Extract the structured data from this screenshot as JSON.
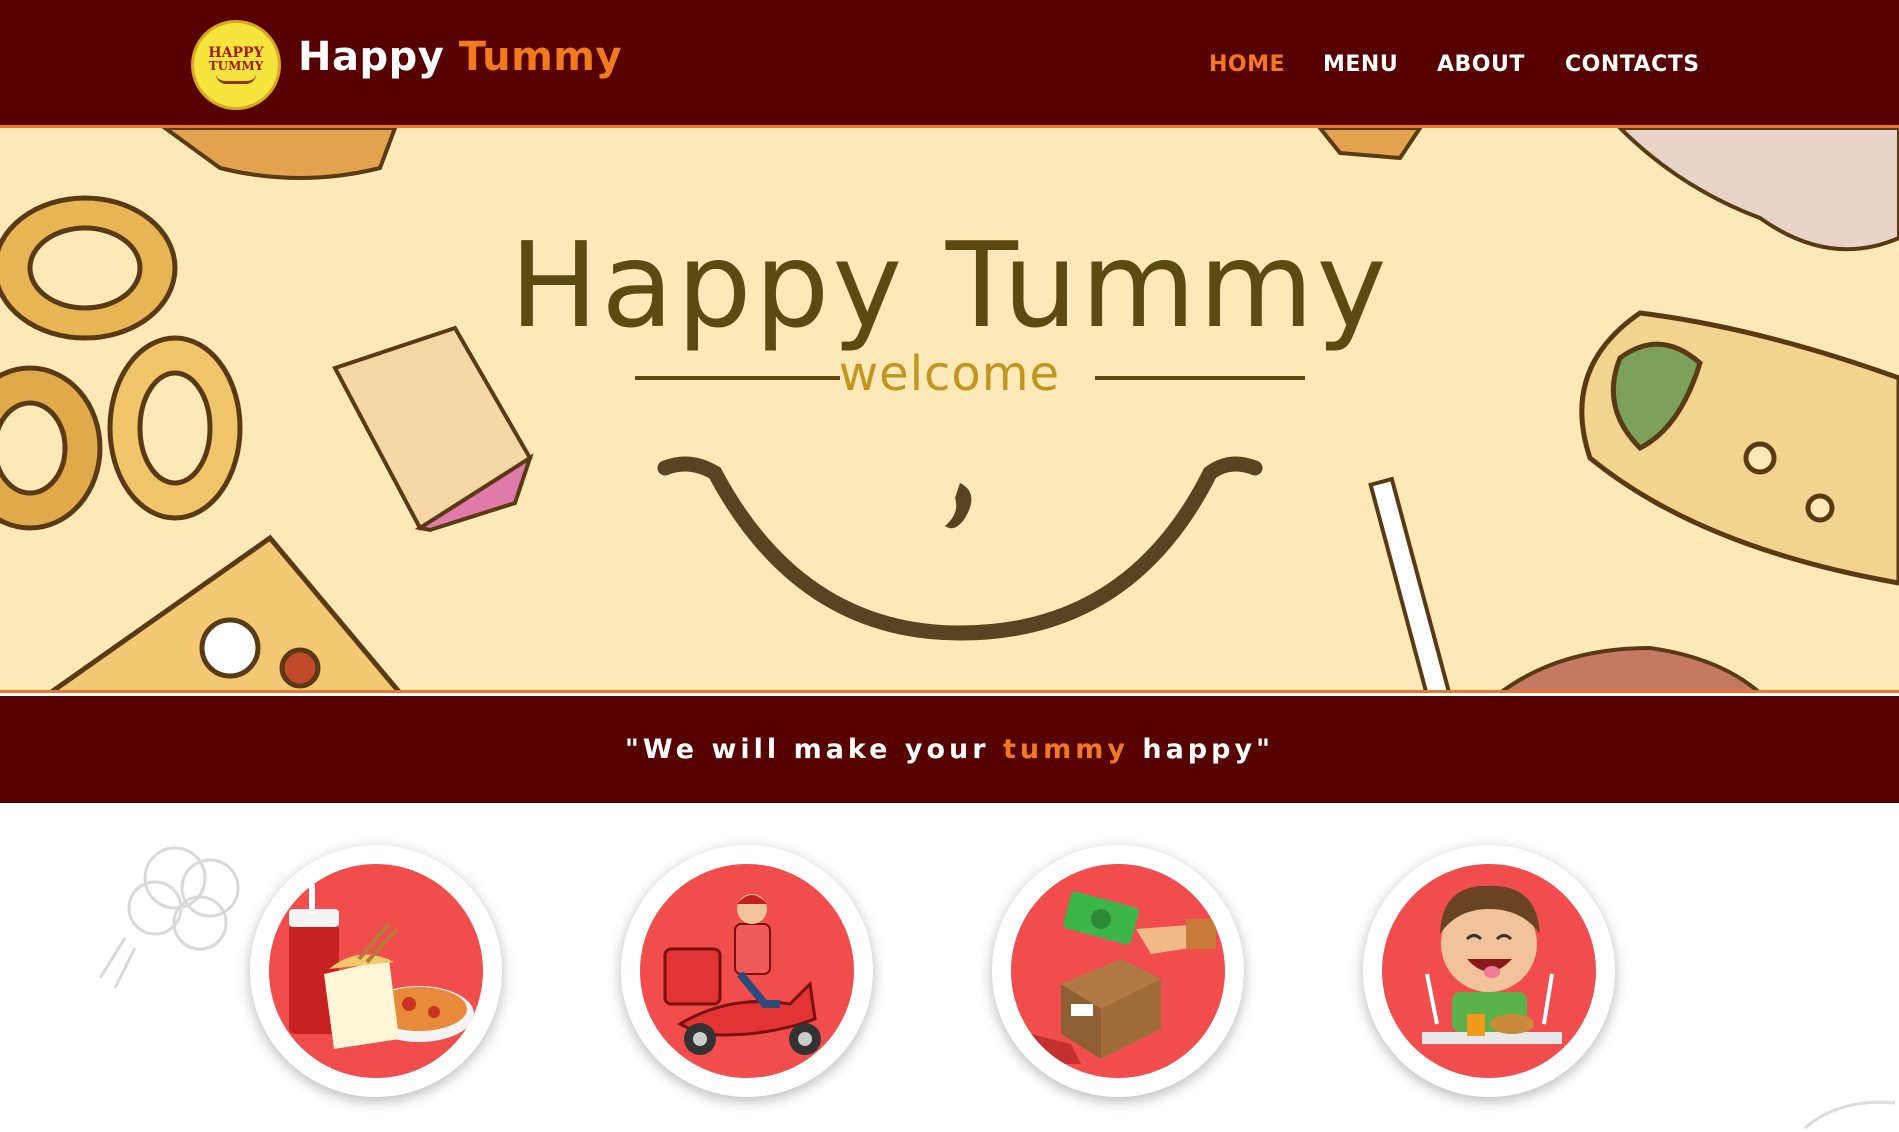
{
  "navbar": {
    "logo": {
      "line1": "HAPPY",
      "line2": "TUMMY"
    },
    "brand": {
      "word1": "Happy",
      "word2": "Tummy"
    },
    "links": [
      {
        "label": "HOME",
        "active": true
      },
      {
        "label": "MENU",
        "active": false
      },
      {
        "label": "ABOUT",
        "active": false
      },
      {
        "label": "CONTACTS",
        "active": false
      }
    ]
  },
  "hero": {
    "title": "Happy Tummy",
    "subtitle": "welcome"
  },
  "tagline": {
    "part1": "\"We will make your ",
    "accent": "tummy",
    "part2": " happy\""
  },
  "features": [
    {
      "icon": "fast-food-icon"
    },
    {
      "icon": "delivery-scooter-icon"
    },
    {
      "icon": "cash-payment-icon"
    },
    {
      "icon": "happy-eater-icon"
    }
  ],
  "colors": {
    "nav_bg": "#570000",
    "accent_orange": "#f27a1e",
    "hero_bg": "#fde9b8",
    "circle_red": "#f24d4d"
  }
}
